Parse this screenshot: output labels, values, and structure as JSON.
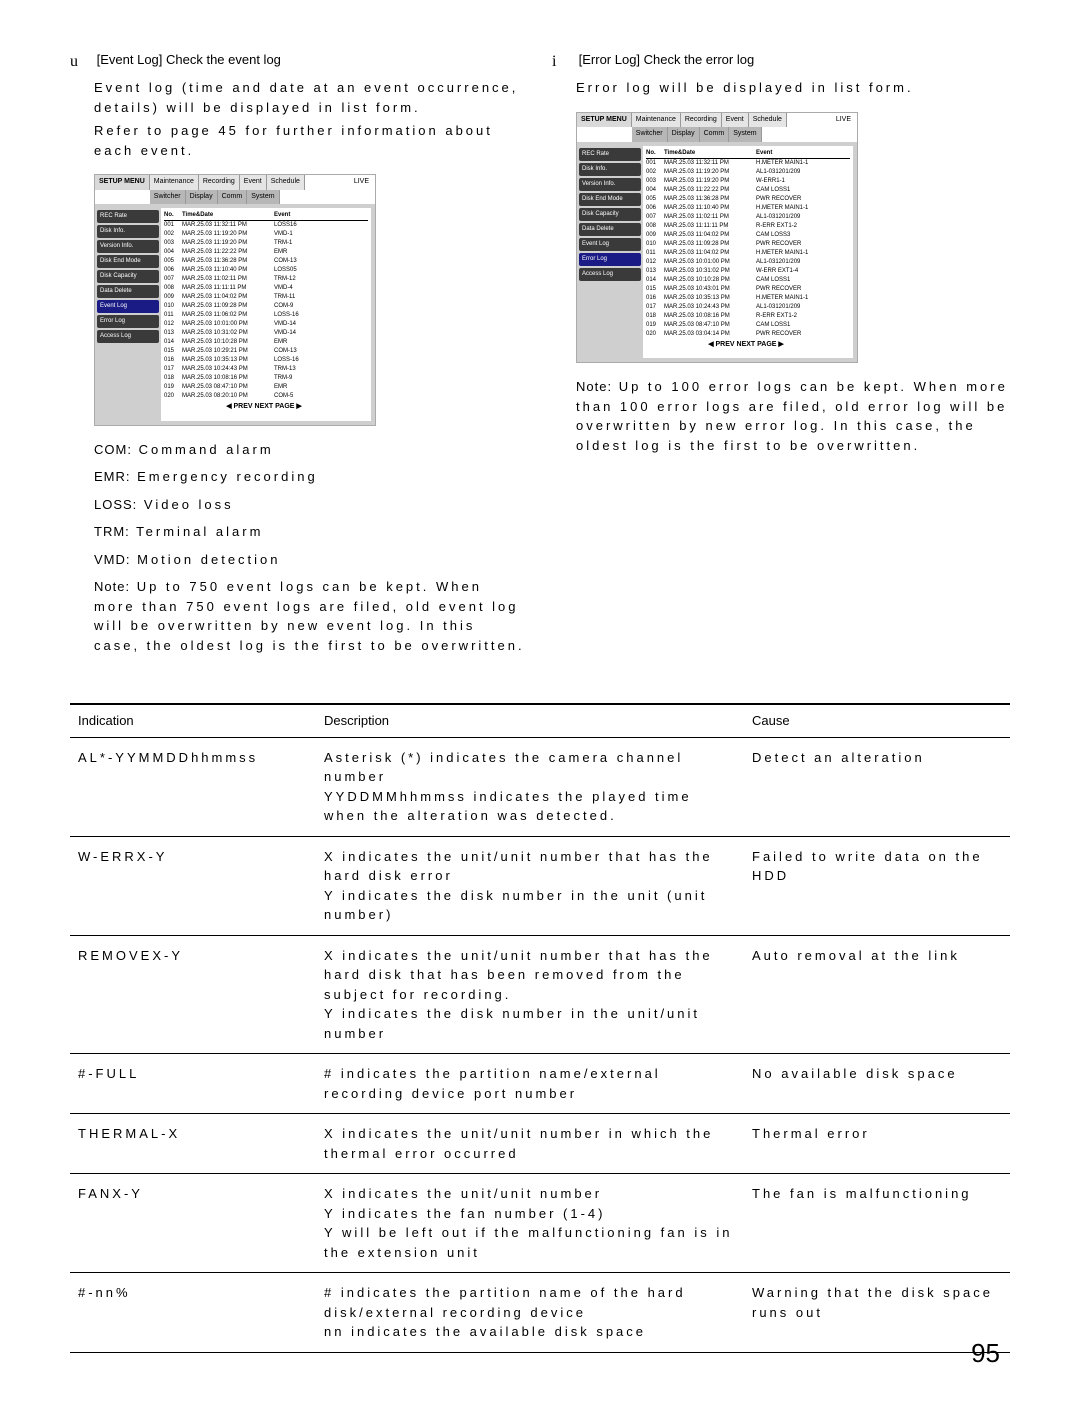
{
  "bullets": {
    "u": "u",
    "i": "i"
  },
  "eventLog": {
    "title": "[Event Log] Check the event log",
    "para1": "Event log (time and date at an event occurrence, details) will be displayed in list form.",
    "para2": "Refer to page 45 for further information about each event."
  },
  "errorLog": {
    "title": "[Error Log] Check the error log",
    "para1": "Error log will be displayed in list form."
  },
  "legend": {
    "com_label": "COM:",
    "com_val": "Command alarm",
    "emr_label": "EMR:",
    "emr_val": "Emergency recording",
    "loss_label": "LOSS:",
    "loss_val": "Video loss",
    "trm_label": "TRM:",
    "trm_val": "Terminal alarm",
    "vmd_label": "VMD:",
    "vmd_val": "Motion detection"
  },
  "eventNote": {
    "head": "Note:",
    "body": "Up to 750 event logs can be kept. When more than 750 event logs are filed, old event log will be overwritten by new event log. In this case, the oldest log is the first to be overwritten."
  },
  "errorNote": {
    "head": "Note:",
    "body": "Up to 100 error logs can be kept. When more than 100 error logs are filed, old error log will be overwritten by new error log. In this case, the oldest log is the first to be overwritten."
  },
  "menu": {
    "setup": "SETUP MENU",
    "live": "LIVE",
    "tabs_top": [
      "Maintenance",
      "Recording",
      "Event",
      "Schedule"
    ],
    "tabs_bot": [
      "Switcher",
      "Display",
      "Comm",
      "System"
    ],
    "side": [
      "REC Rate",
      "Disk Info.",
      "Version Info.",
      "Disk End Mode",
      "Disk Capacity",
      "Data Delete",
      "Event Log",
      "Error Log",
      "Access Log"
    ],
    "cols": [
      "No.",
      "Time&Date",
      "Event"
    ],
    "pager": "◀ PREV NEXT PAGE ▶"
  },
  "eventRows": [
    {
      "n": "001",
      "t": "MAR.25.03 11:32:11 PM",
      "e": "LOSS16"
    },
    {
      "n": "002",
      "t": "MAR.25.03 11:19:20 PM",
      "e": "VMD-1"
    },
    {
      "n": "003",
      "t": "MAR.25.03 11:19:20 PM",
      "e": "TRM-1"
    },
    {
      "n": "004",
      "t": "MAR.25.03 11:22:22 PM",
      "e": "EMR"
    },
    {
      "n": "005",
      "t": "MAR.25.03 11:36:28 PM",
      "e": "COM-13"
    },
    {
      "n": "006",
      "t": "MAR.25.03 11:10:40 PM",
      "e": "LOSS05"
    },
    {
      "n": "007",
      "t": "MAR.25.03 11:02:11 PM",
      "e": "TRM-12"
    },
    {
      "n": "008",
      "t": "MAR.25.03 11:11:11 PM",
      "e": "VMD-4"
    },
    {
      "n": "009",
      "t": "MAR.25.03 11:04:02 PM",
      "e": "TRM-11"
    },
    {
      "n": "010",
      "t": "MAR.25.03 11:09:28 PM",
      "e": "COM-9"
    },
    {
      "n": "011",
      "t": "MAR.25.03 11:06:02 PM",
      "e": "LOSS-16"
    },
    {
      "n": "012",
      "t": "MAR.25.03 10:01:00 PM",
      "e": "VMD-14"
    },
    {
      "n": "013",
      "t": "MAR.25.03 10:31:02 PM",
      "e": "VMD-14"
    },
    {
      "n": "014",
      "t": "MAR.25.03 10:10:28 PM",
      "e": "EMR"
    },
    {
      "n": "015",
      "t": "MAR.25.03 10:29:21 PM",
      "e": "COM-13"
    },
    {
      "n": "016",
      "t": "MAR.25.03 10:35:13 PM",
      "e": "LOSS-16"
    },
    {
      "n": "017",
      "t": "MAR.25.03 10:24:43 PM",
      "e": "TRM-13"
    },
    {
      "n": "018",
      "t": "MAR.25.03 10:08:16 PM",
      "e": "TRM-9"
    },
    {
      "n": "019",
      "t": "MAR.25.03 08:47:10 PM",
      "e": "EMR"
    },
    {
      "n": "020",
      "t": "MAR.25.03 08:20:10 PM",
      "e": "COM-5"
    }
  ],
  "errorRows": [
    {
      "n": "001",
      "t": "MAR.25.03 11:32:11 PM",
      "e": "H.METER MAIN1-1"
    },
    {
      "n": "002",
      "t": "MAR.25.03 11:19:20 PM",
      "e": "AL1-031201/209"
    },
    {
      "n": "003",
      "t": "MAR.25.03 11:19:20 PM",
      "e": "W-ERR1-1"
    },
    {
      "n": "004",
      "t": "MAR.25.03 11:22:22 PM",
      "e": "CAM LOSS1"
    },
    {
      "n": "005",
      "t": "MAR.25.03 11:36:28 PM",
      "e": "PWR RECOVER"
    },
    {
      "n": "006",
      "t": "MAR.25.03 11:10:40 PM",
      "e": "H.METER MAIN1-1"
    },
    {
      "n": "007",
      "t": "MAR.25.03 11:02:11 PM",
      "e": "AL1-031201/209"
    },
    {
      "n": "008",
      "t": "MAR.25.03 11:11:11 PM",
      "e": "R-ERR EXT1-2"
    },
    {
      "n": "009",
      "t": "MAR.25.03 11:04:02 PM",
      "e": "CAM LOSS3"
    },
    {
      "n": "010",
      "t": "MAR.25.03 11:09:28 PM",
      "e": "PWR RECOVER"
    },
    {
      "n": "011",
      "t": "MAR.25.03 11:04:02 PM",
      "e": "H.METER MAIN1-1"
    },
    {
      "n": "012",
      "t": "MAR.25.03 10:01:00 PM",
      "e": "AL1-031201/209"
    },
    {
      "n": "013",
      "t": "MAR.25.03 10:31:02 PM",
      "e": "W-ERR EXT1-4"
    },
    {
      "n": "014",
      "t": "MAR.25.03 10:10:28 PM",
      "e": "CAM LOSS1"
    },
    {
      "n": "015",
      "t": "MAR.25.03 10:43:01 PM",
      "e": "PWR RECOVER"
    },
    {
      "n": "016",
      "t": "MAR.25.03 10:35:13 PM",
      "e": "H.METER MAIN1-1"
    },
    {
      "n": "017",
      "t": "MAR.25.03 10:24:43 PM",
      "e": "AL1-031201/209"
    },
    {
      "n": "018",
      "t": "MAR.25.03 10:08:16 PM",
      "e": "R-ERR EXT1-2"
    },
    {
      "n": "019",
      "t": "MAR.25.03 08:47:10 PM",
      "e": "CAM LOSS1"
    },
    {
      "n": "020",
      "t": "MAR.25.03 03:04:14 PM",
      "e": "PWR RECOVER"
    }
  ],
  "table": {
    "headers": [
      "Indication",
      "Description",
      "Cause"
    ],
    "rows": [
      {
        "ind": "AL*-YYMMDDhhmmss",
        "desc": "Asterisk (*) indicates the camera channel number\nYYDDMMhhmmss indicates the played time when the alteration was detected.",
        "cause": "Detect an alteration"
      },
      {
        "ind": "W-ERRX-Y",
        "desc": "X indicates the unit/unit number that has the hard disk error\nY indicates the disk number in the unit (unit number)",
        "cause": "Failed to write data on the HDD"
      },
      {
        "ind": "REMOVEX-Y",
        "desc": "X indicates the unit/unit number that has the hard disk that has been removed from the subject for recording.\nY indicates the disk number in the unit/unit number",
        "cause": "Auto removal at the link"
      },
      {
        "ind": "#-FULL",
        "desc": "# indicates the partition name/external recording device port number",
        "cause": "No available disk space"
      },
      {
        "ind": "THERMAL-X",
        "desc": "X indicates the unit/unit number in which the thermal error occurred",
        "cause": "Thermal error"
      },
      {
        "ind": "FANX-Y",
        "desc": "X indicates the unit/unit number\nY indicates the fan number (1-4)\nY will be left out if the malfunctioning fan is in the extension unit",
        "cause": "The fan is malfunctioning"
      },
      {
        "ind": "#-nn%",
        "desc": "# indicates the partition name of the hard disk/external recording device\nnn indicates the available disk space",
        "cause": "Warning that the disk space runs out"
      }
    ]
  },
  "pageNumber": "95"
}
